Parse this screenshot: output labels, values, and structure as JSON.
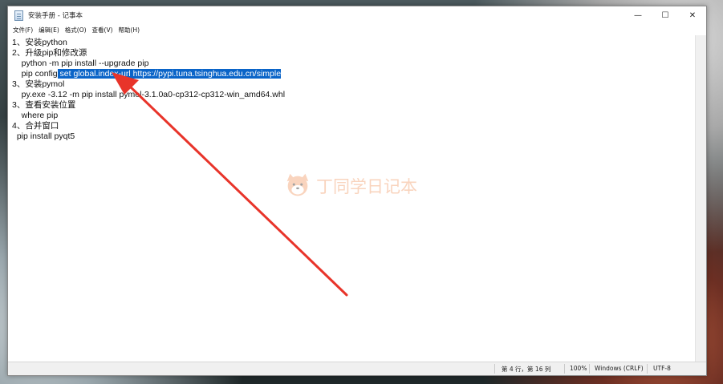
{
  "window": {
    "title": "安装手册 - 记事本",
    "controls": {
      "minimize": "—",
      "maximize": "☐",
      "close": "✕"
    }
  },
  "menubar": {
    "items": [
      "文件(F)",
      "编辑(E)",
      "格式(O)",
      "查看(V)",
      "帮助(H)"
    ]
  },
  "editor": {
    "lines": [
      "1、安装python",
      "2、升级pip和修改源",
      "    python -m pip install --upgrade pip",
      "    pip config",
      "3、安装pymol",
      "    py.exe -3.12 -m pip install pymol-3.1.0a0-cp312-cp312-win_amd64.whl",
      "3、查看安装位置",
      "    where pip",
      "4、合并窗口",
      "  pip install pyqt5"
    ],
    "selected_text": " set global.index-url https://pypi.tuna.tsinghua.edu.cn/simple"
  },
  "statusbar": {
    "position": "第 4 行，第 16 列",
    "zoom": "100%",
    "line_ending": "Windows (CRLF)",
    "encoding": "UTF-8"
  },
  "watermark": {
    "text": "丁同学日记本"
  },
  "colors": {
    "selection": "#0a64c8",
    "arrow": "#e8342a",
    "watermark": "#f2a271"
  }
}
